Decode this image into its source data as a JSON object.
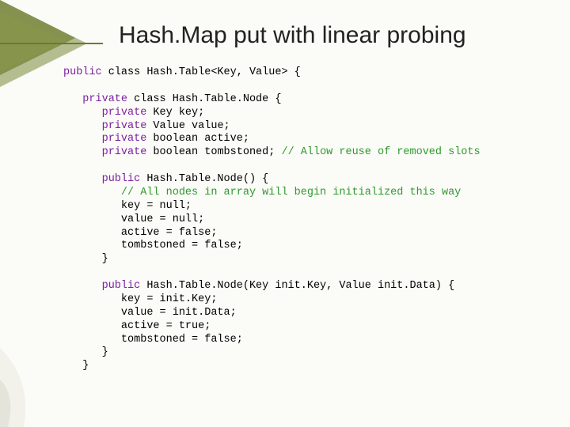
{
  "title": "Hash.Map put with linear probing",
  "code": {
    "l01a": "public",
    "l01b": " class Hash.Table<Key, Value> {",
    "l02": "",
    "l03a": "   private",
    "l03b": " class Hash.Table.Node {",
    "l04a": "      private",
    "l04b": " Key key;",
    "l05a": "      private",
    "l05b": " Value value;",
    "l06a": "      private",
    "l06b": " boolean active;",
    "l07a": "      private",
    "l07b": " boolean tombstoned; ",
    "l07c": "// Allow reuse of removed slots",
    "l08": "",
    "l09a": "      public",
    "l09b": " Hash.Table.Node() {",
    "l10": "         // All nodes in array will begin initialized this way",
    "l11": "         key = null;",
    "l12": "         value = null;",
    "l13": "         active = false;",
    "l14": "         tombstoned = false;",
    "l15": "      }",
    "l16": "",
    "l17a": "      public",
    "l17b": " Hash.Table.Node(Key init.Key, Value init.Data) {",
    "l18": "         key = init.Key;",
    "l19": "         value = init.Data;",
    "l20": "         active = true;",
    "l21": "         tombstoned = false;",
    "l22": "      }",
    "l23": "   }"
  }
}
